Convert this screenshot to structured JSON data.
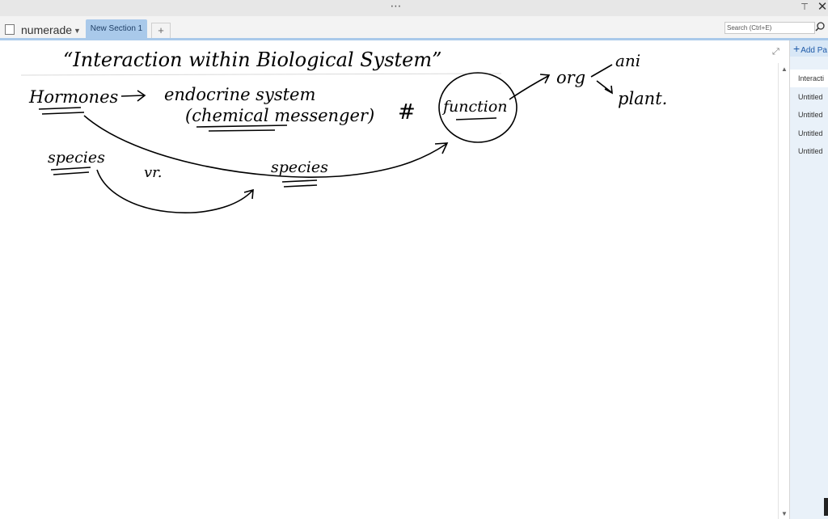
{
  "window": {
    "more_glyph": "⋯",
    "pin_glyph": "⊤",
    "close_glyph": "✕"
  },
  "notebook": {
    "name": "numerade",
    "caret": "▼"
  },
  "sections": {
    "active_tab": "New Section 1",
    "add_label": "+"
  },
  "search": {
    "placeholder": "Search (Ctrl+E)"
  },
  "pages": {
    "add_label": "Add Pa",
    "add_plus": "+",
    "items": [
      "Interacti",
      "Untitled",
      "Untitled",
      "Untitled",
      "Untitled"
    ]
  },
  "note": {
    "title": "“Interaction within Biological System”",
    "line1_left": "Hormones",
    "line1_mid": "endocrine system",
    "line2": "(chemical messenger)",
    "hash": "#",
    "circled": "function",
    "org": "org",
    "branch_top": "ani",
    "branch_bottom": "plant.",
    "species_left": "species",
    "vs": "vr.",
    "species_right": "species"
  },
  "colors": {
    "section_tab": "#a9c9ea",
    "accent": "#1e5aa8"
  },
  "icons": {
    "expand": "⤢",
    "scroll_up": "▲",
    "scroll_down": "▼"
  }
}
